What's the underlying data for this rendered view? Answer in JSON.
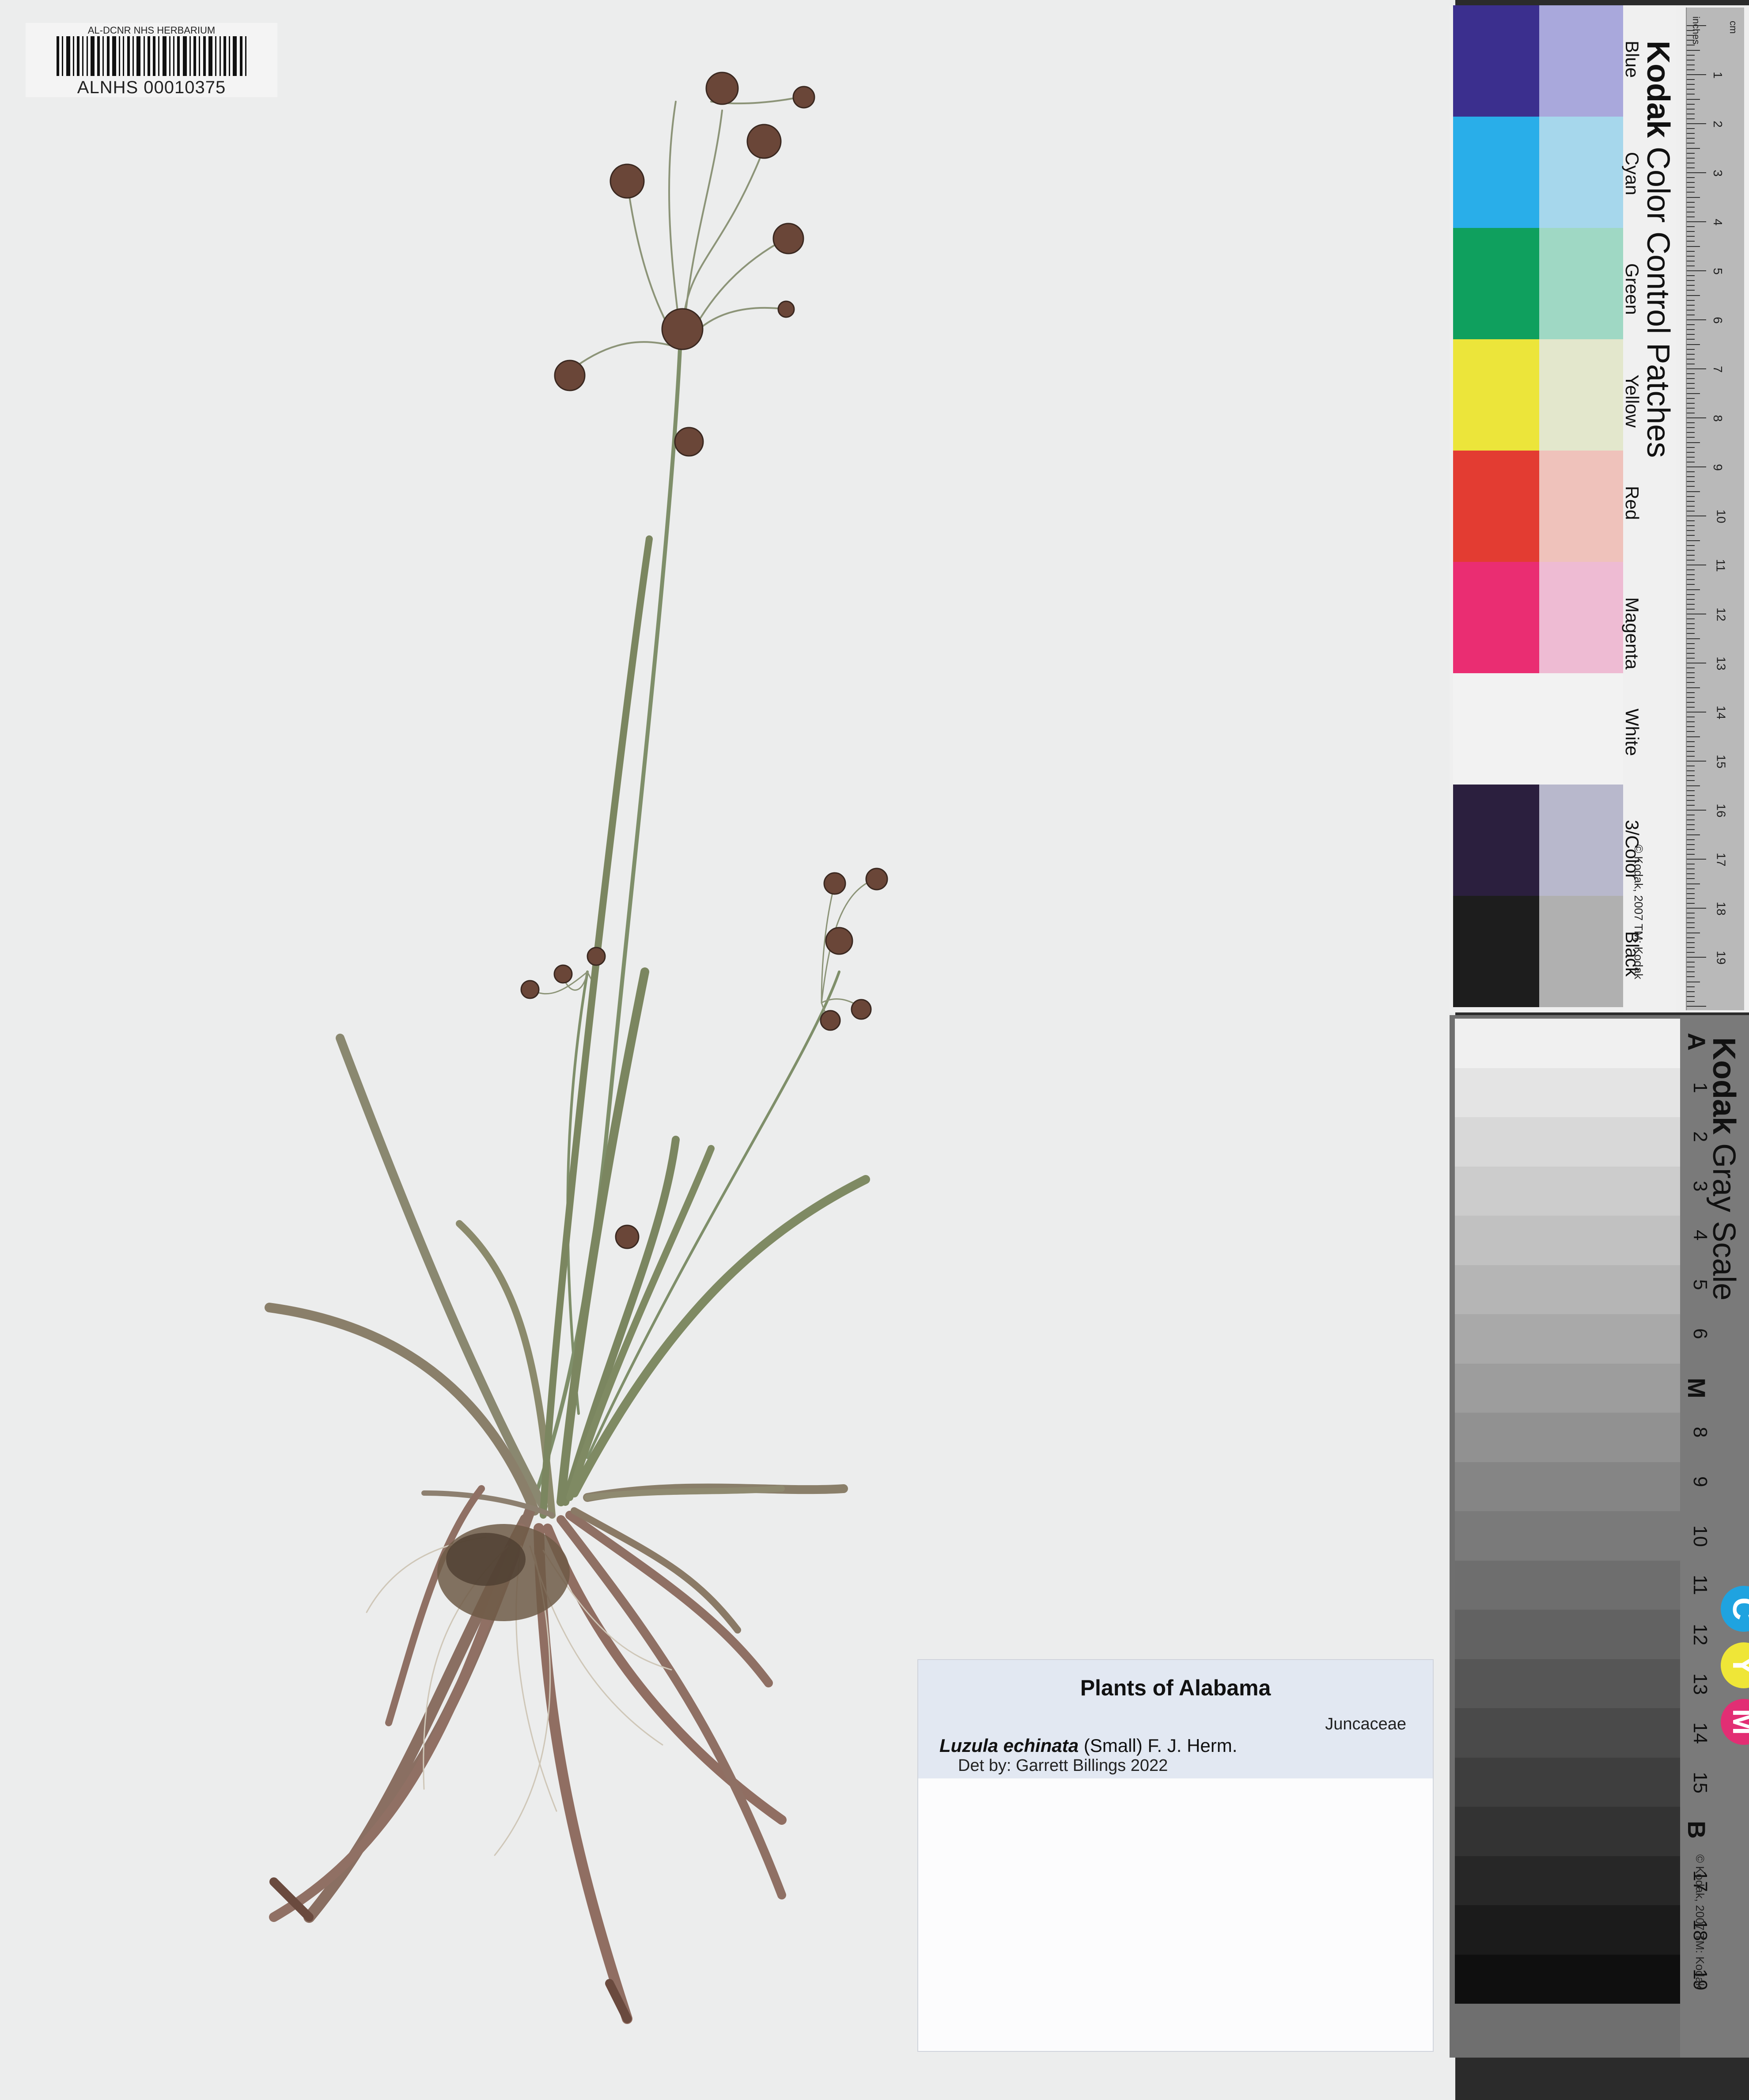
{
  "herbarium": {
    "barcode_title": "AL-DCNR NHS HERBARIUM",
    "barcode_number": "ALNHS 00010375"
  },
  "label": {
    "title": "Plants of Alabama",
    "family": "Juncaceae",
    "taxon_name": "Luzula echinata",
    "taxon_authority": "(Small) F. J. Herm.",
    "determiner": "Det by: Garrett Billings 2022"
  },
  "color_chart": {
    "brand": "Kodak",
    "title": "Color Control Patches",
    "copyright": "© Kodak, 2007 TM: Kodak",
    "ruler_units_top": "cm",
    "ruler_units_inches": "inches",
    "cm_marks": [
      "1",
      "2",
      "3",
      "4",
      "5",
      "6",
      "7",
      "8",
      "9",
      "10",
      "11",
      "12",
      "13",
      "14",
      "15",
      "16",
      "17",
      "18",
      "19"
    ],
    "patches": [
      {
        "name": "Blue",
        "dark": "#3b2f8e",
        "light": "#a9a8dc"
      },
      {
        "name": "Cyan",
        "dark": "#29aee9",
        "light": "#a6d7ec"
      },
      {
        "name": "Green",
        "dark": "#0fa05e",
        "light": "#9fd8c4"
      },
      {
        "name": "Yellow",
        "dark": "#ece53a",
        "light": "#e3e7cc"
      },
      {
        "name": "Red",
        "dark": "#e33c32",
        "light": "#efc2bb"
      },
      {
        "name": "Magenta",
        "dark": "#ea2d72",
        "light": "#eebbd3"
      },
      {
        "name": "White",
        "dark": "#f2f2f2",
        "light": "#f2f2f2"
      },
      {
        "name": "3/Color",
        "dark": "#2b1f3e",
        "light": "#b8b8cc"
      },
      {
        "name": "Black",
        "dark": "#1d1d1d",
        "light": "#b0b0b0"
      }
    ]
  },
  "gray_scale": {
    "brand": "Kodak",
    "title": "Gray Scale",
    "copyright": "© Kodak, 2007 TM: Kodak",
    "steps": [
      "A",
      "1",
      "2",
      "3",
      "4",
      "5",
      "6",
      "M",
      "8",
      "9",
      "10",
      "11",
      "12",
      "13",
      "14",
      "15",
      "B",
      "17",
      "18",
      "19"
    ],
    "cym": [
      {
        "letter": "C",
        "color": "#1fa3e0"
      },
      {
        "letter": "Y",
        "color": "#efe637"
      },
      {
        "letter": "M",
        "color": "#e22e74"
      }
    ]
  }
}
